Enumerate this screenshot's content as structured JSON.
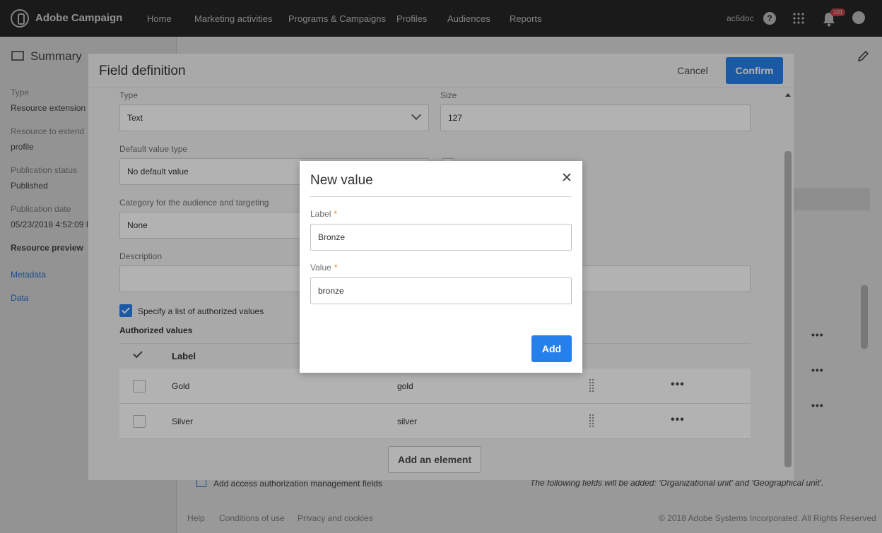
{
  "app": {
    "brand": "Adobe Campaign",
    "nav": [
      "Home",
      "Marketing activities",
      "Programs & Campaigns",
      "Profiles",
      "Audiences",
      "Reports"
    ],
    "user": "ac6doc",
    "notification_count": "101"
  },
  "summary": {
    "title": "Summary",
    "type_label": "Type",
    "type_value": "Resource extension",
    "resource_label": "Resource to extend",
    "resource_value": "profile",
    "status_label": "Publication status",
    "status_value": "Published",
    "date_label": "Publication date",
    "date_value": "05/23/2018 4:52:09 P",
    "preview_title": "Resource preview",
    "links": [
      "Metadata",
      "Data"
    ]
  },
  "background": {
    "access_fields_label": "Add access authorization management fields",
    "info_text": "The following fields will be added: 'Organizational unit' and 'Geographical unit'.",
    "footer_links": [
      "Help",
      "Conditions of use",
      "Privacy and cookies"
    ],
    "copyright": "© 2018 Adobe Systems Incorporated. All Rights Reserved"
  },
  "field_definition": {
    "title": "Field definition",
    "cancel_label": "Cancel",
    "confirm_label": "Confirm",
    "type_label": "Type",
    "type_value": "Text",
    "size_label": "Size",
    "size_value": "127",
    "default_type_label": "Default value type",
    "default_type_value": "No default value",
    "category_label": "Category for the audience and targeting",
    "category_value": "None",
    "description_label": "Description",
    "description_value": "",
    "authorized_checkbox_label": "Specify a list of authorized values",
    "authorized_title": "Authorized values",
    "table_header_label": "Label",
    "rows": [
      {
        "label": "Gold",
        "value": "gold"
      },
      {
        "label": "Silver",
        "value": "silver"
      }
    ],
    "add_element_label": "Add an element"
  },
  "new_value": {
    "title": "New value",
    "label_field_label": "Label",
    "label_value": "Bronze",
    "value_field_label": "Value",
    "value_value": "bronze",
    "required_mark": "*",
    "add_label": "Add"
  },
  "colors": {
    "accent": "#2680eb",
    "topbar": "#2c2c2c",
    "required": "#e68619"
  }
}
